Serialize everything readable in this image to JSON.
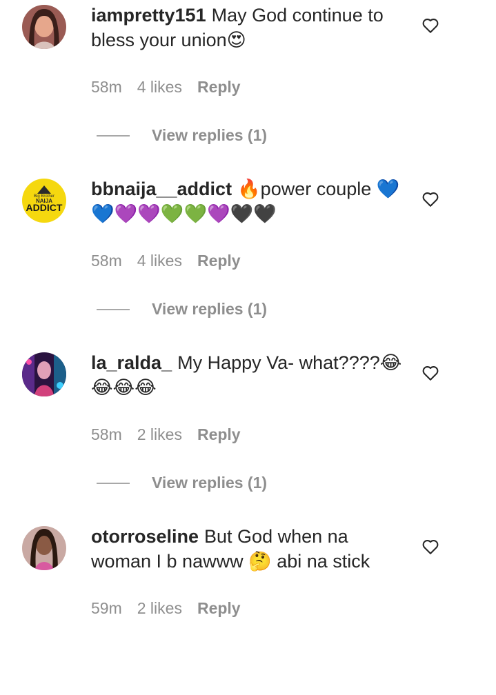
{
  "comments": [
    {
      "username": "iampretty151",
      "text": "May God continue to bless your union😍",
      "time": "58m",
      "likes": "4 likes",
      "reply": "Reply",
      "view_replies": "View replies (1)",
      "avatar": "woman-portrait"
    },
    {
      "username": "bbnaija__addict",
      "text": "🔥power couple 💙💙💜💜💚💚💜🖤🖤",
      "time": "58m",
      "likes": "4 likes",
      "reply": "Reply",
      "view_replies": "View replies (1)",
      "avatar": "logo",
      "avatar_logo_text": [
        "Big Brother",
        "NAIJA",
        "ADDICT"
      ]
    },
    {
      "username": "la_ralda_",
      "text": "My Happy Va- what????😂😂😂😂",
      "time": "58m",
      "likes": "2 likes",
      "reply": "Reply",
      "view_replies": "View replies (1)",
      "avatar": "neon-portrait"
    },
    {
      "username": "otorroseline",
      "text": "But God when na woman I b nawww 🤔 abi na stick",
      "time": "59m",
      "likes": "2 likes",
      "reply": "Reply",
      "avatar": "woman-portrait"
    }
  ],
  "icons": {
    "like": "heart-outline-icon"
  },
  "colors": {
    "text": "#262626",
    "meta": "#8e8e8e",
    "avatar_logo_bg": "#f5d80f"
  }
}
